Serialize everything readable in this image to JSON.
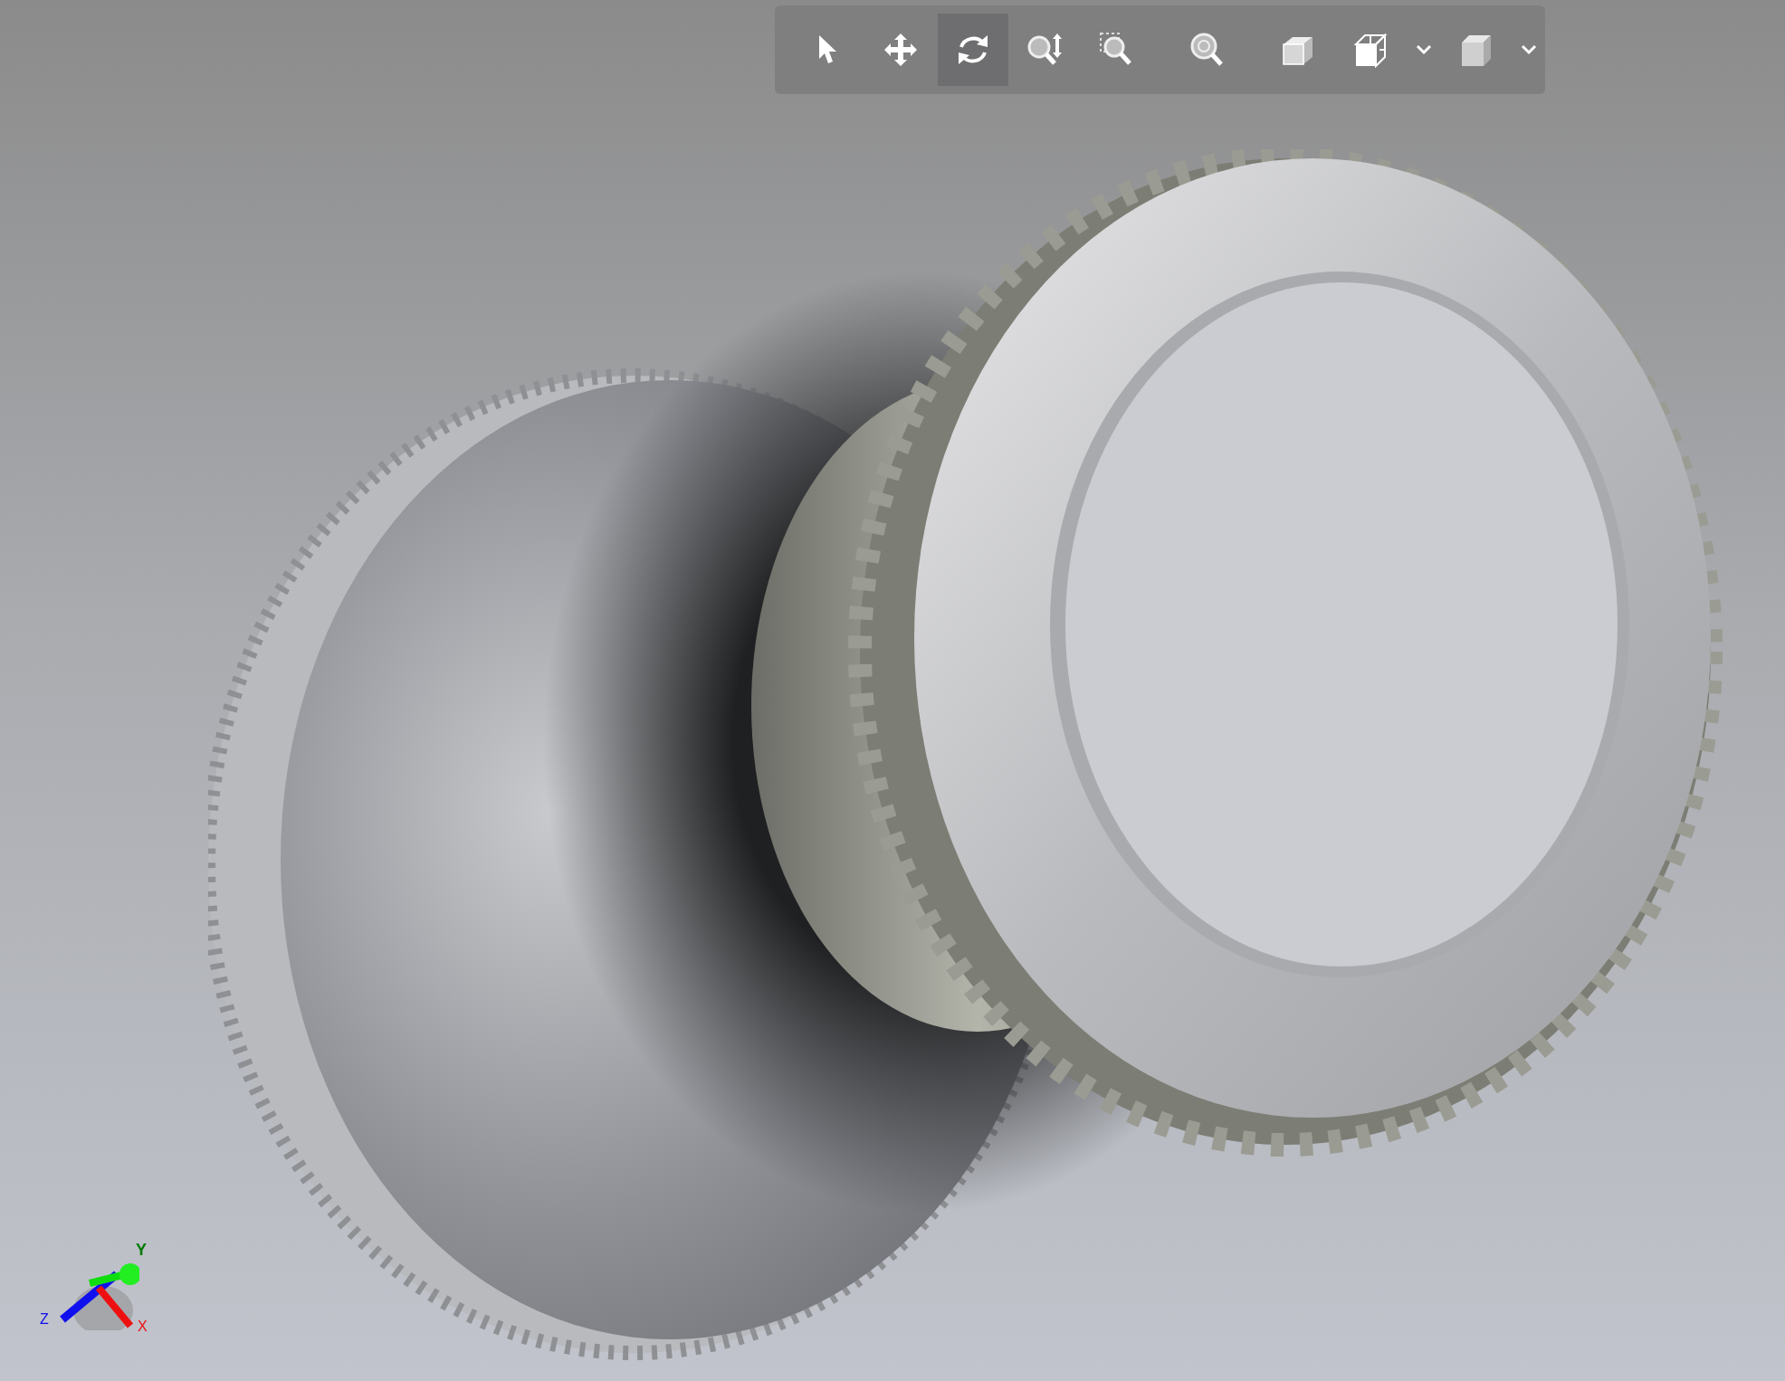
{
  "toolbar": {
    "tools": [
      {
        "selected": false,
        "dropdown": false
      },
      {
        "selected": false,
        "dropdown": false
      },
      {
        "selected": true,
        "dropdown": false
      },
      {
        "selected": false,
        "dropdown": false
      },
      {
        "selected": false,
        "dropdown": false
      },
      {
        "selected": false,
        "dropdown": false
      },
      {
        "selected": false,
        "dropdown": false
      },
      {
        "selected": false,
        "dropdown": true
      },
      {
        "selected": false,
        "dropdown": true
      }
    ]
  },
  "axis_triad": {
    "x_label": "X",
    "y_label": "Y",
    "z_label": "Z"
  }
}
